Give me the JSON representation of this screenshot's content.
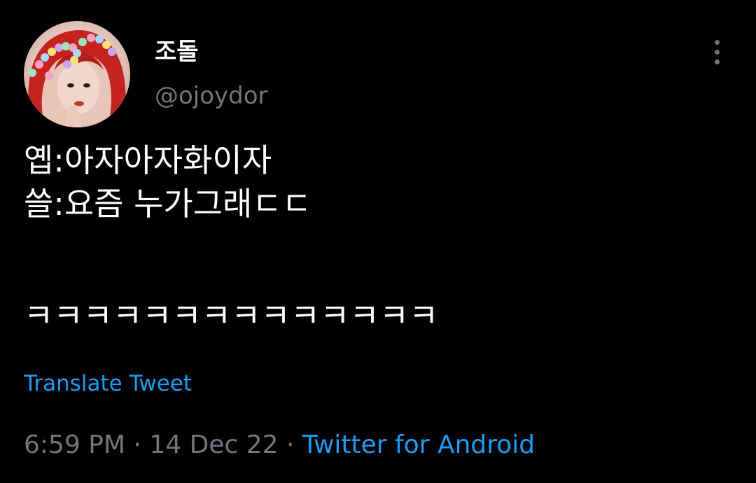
{
  "colors": {
    "background": "#000000",
    "text": "#ffffff",
    "muted": "#71767b",
    "accent": "#1d9bf0"
  },
  "author": {
    "display_name": "조돌",
    "handle": "@ojoydor",
    "avatar_icon": "profile-photo"
  },
  "menu": {
    "icon": "more-vertical-icon"
  },
  "tweet": {
    "lines": [
      "옙:아자아자화이자",
      "쓸:요즘 누가그래ㄷㄷ",
      "",
      "ㅋㅋㅋㅋㅋㅋㅋㅋㅋㅋㅋㅋㅋㅋ"
    ],
    "translate_label": "Translate Tweet",
    "time": "6:59 PM",
    "separator": " · ",
    "date": "14 Dec 22",
    "source": "Twitter for Android"
  }
}
